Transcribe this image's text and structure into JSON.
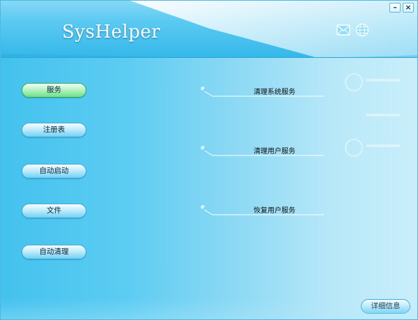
{
  "app": {
    "title": "SysHelper"
  },
  "window_controls": {
    "minimize": "–",
    "close": "×"
  },
  "header": {
    "mail_icon": "mail-icon",
    "globe_icon": "globe-icon"
  },
  "nav": {
    "items": [
      {
        "label": "服务",
        "active": true
      },
      {
        "label": "注册表",
        "active": false
      },
      {
        "label": "自动启动",
        "active": false
      },
      {
        "label": "文件",
        "active": false
      },
      {
        "label": "自动清理",
        "active": false
      }
    ]
  },
  "services": {
    "items": [
      {
        "label": "清理系统服务"
      },
      {
        "label": "清理用户服务"
      },
      {
        "label": "恢复用户服务"
      }
    ]
  },
  "footer": {
    "detail_button": "详细信息"
  },
  "colors": {
    "accent": "#35b8ea",
    "active_button": "#6ee08a",
    "button": "#6fd1f3"
  }
}
